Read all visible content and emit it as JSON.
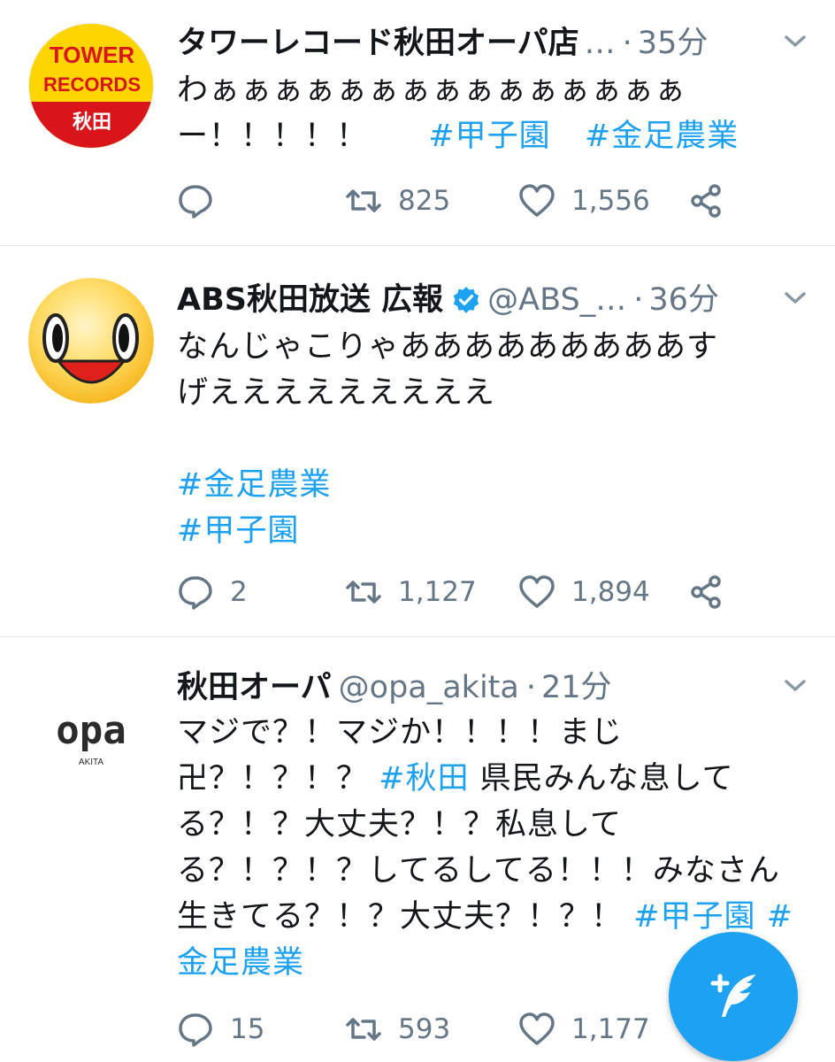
{
  "tweets": [
    {
      "name": "タワーレコード秋田オーパ店",
      "handle_truncated": "…",
      "separator": "·",
      "time": "35分",
      "text": "わぁぁぁぁぁぁぁぁぁぁぁぁぁぁぁー！！！！！",
      "hashtags": [
        "#甲子園",
        "#金足農業"
      ],
      "replies": "",
      "retweets": "825",
      "likes": "1,556",
      "avatar_logo_lines": [
        "TOWER",
        "RECORDS",
        "秋田"
      ]
    },
    {
      "name": "ABS秋田放送 広報",
      "handle": "@ABS_…",
      "separator": "·",
      "time": "36分",
      "text_line1": "なんじゃこりゃあああああああああす",
      "text_line2": "げえええええええええ",
      "hashtags": [
        "#金足農業",
        "#甲子園"
      ],
      "replies": "2",
      "retweets": "1,127",
      "likes": "1,894"
    },
    {
      "name": "秋田オーパ",
      "handle": "@opa_akita",
      "separator": "·",
      "time": "21分",
      "text_part1": "マジで？！マジか！！！！まじ卍？！？！？",
      "hashtag_mid": "#秋田",
      "text_part2": "県民みんな息してる？！？大丈夫？！？私息してる？！？！？してるしてる！！！みなさん生きてる？！？大丈夫？！？！",
      "hashtags": [
        "#甲子園",
        "#金足農業"
      ],
      "replies": "15",
      "retweets": "593",
      "likes": "1,177",
      "avatar_logo_lines": [
        "opa",
        "AKITA"
      ]
    }
  ],
  "icons": {
    "reply": "reply-icon",
    "retweet": "retweet-icon",
    "like": "heart-icon",
    "share": "share-icon",
    "more": "chevron-down-icon",
    "verified": "verified-badge-icon",
    "compose": "compose-tweet-icon"
  },
  "colors": {
    "accent": "#1da1f2",
    "muted": "#657786",
    "divider": "#e1e8ed"
  }
}
